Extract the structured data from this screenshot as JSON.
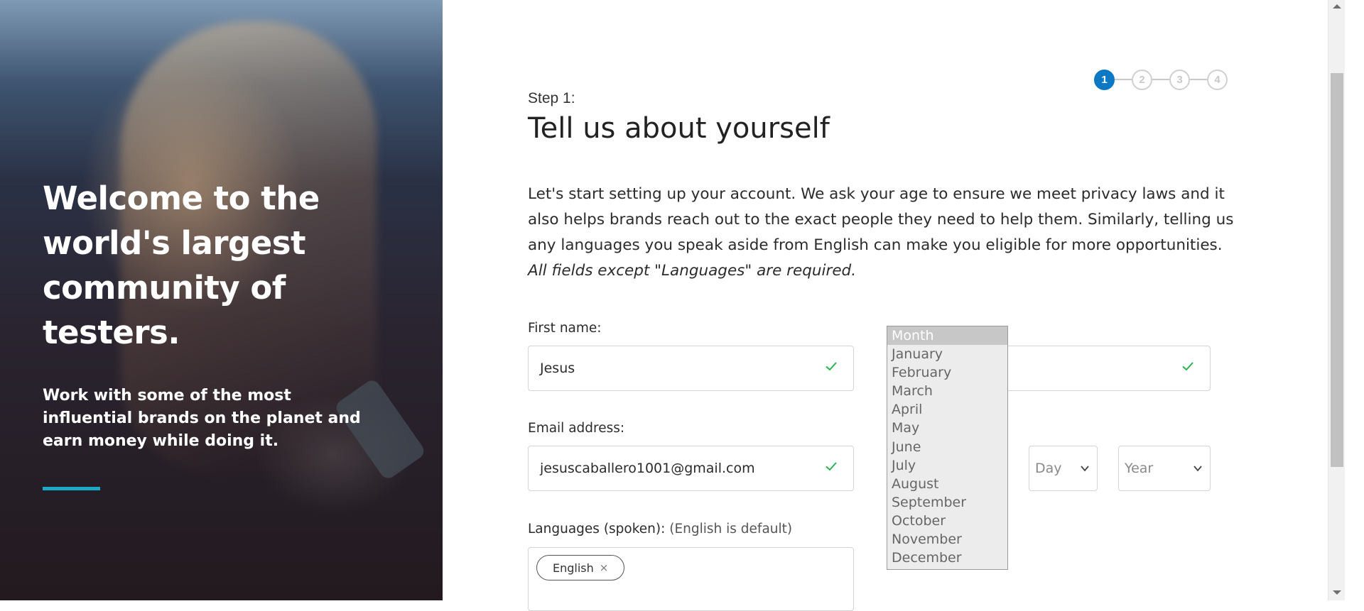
{
  "hero": {
    "heading": "Welcome to the world's largest community of testers.",
    "subheading": "Work with some of the most influential brands on the planet and earn money while doing it.",
    "accent_color": "#1ba9c6"
  },
  "stepper": {
    "steps": [
      "1",
      "2",
      "3",
      "4"
    ],
    "active_index": 0,
    "active_color": "#0d78c3"
  },
  "form": {
    "step_label": "Step 1:",
    "title": "Tell us about yourself",
    "intro": "Let's start setting up your account. We ask your age to ensure we meet privacy laws and it also helps brands reach out to the exact people they need to help them. Similarly, telling us any languages you speak aside from English can make you eligible for more opportunities.",
    "intro_italic": "All fields except \"Languages\" are required.",
    "first_name": {
      "label": "First name:",
      "value": "Jesus"
    },
    "email": {
      "label": "Email address:",
      "value": "jesuscaballero1001@gmail.com"
    },
    "day": {
      "value": "Day"
    },
    "year": {
      "value": "Year"
    },
    "languages": {
      "label": "Languages (spoken):",
      "hint": "(English is default)",
      "tags": [
        "English"
      ],
      "remove_glyph": "×"
    },
    "month_dropdown": {
      "options": [
        "Month",
        "January",
        "February",
        "March",
        "April",
        "May",
        "June",
        "July",
        "August",
        "September",
        "October",
        "November",
        "December"
      ],
      "selected_index": 0
    },
    "valid_color": "#2bb24c"
  },
  "icons": {
    "check": "check-icon",
    "chevron": "chevron-down-icon",
    "remove": "close-icon"
  }
}
